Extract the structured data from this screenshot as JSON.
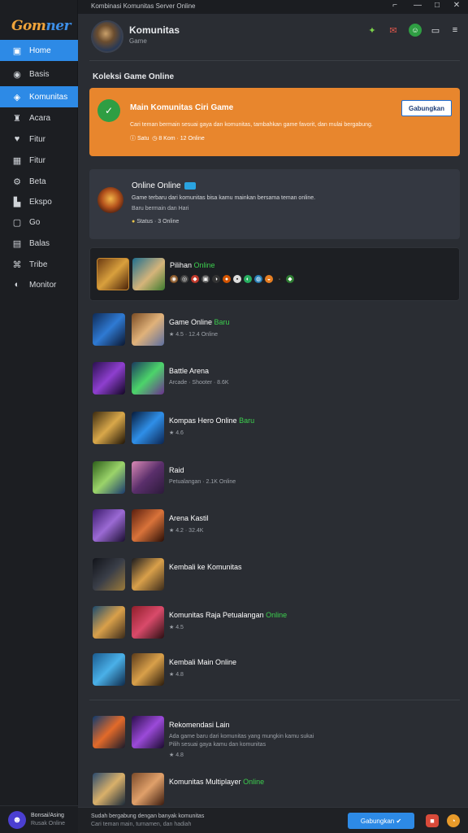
{
  "titlebar": {
    "text": "Kombinasi Komunitas Server Online",
    "pin": "⌐",
    "minimize": "—",
    "maximize": "□",
    "close": "✕"
  },
  "sidebar": {
    "logo_a": "Gom",
    "logo_b": "ner",
    "items": [
      {
        "label": "Home",
        "icon": "home-icon",
        "glyph": "▣"
      },
      {
        "label": "Basis",
        "icon": "compass-icon",
        "glyph": "◉"
      },
      {
        "label": "Komunitas",
        "icon": "community-icon",
        "glyph": "◈"
      },
      {
        "label": "Acara",
        "icon": "crown-icon",
        "glyph": "♜"
      },
      {
        "label": "Fitur",
        "icon": "heart-icon",
        "glyph": "♥"
      },
      {
        "label": "Fitur",
        "icon": "store-icon",
        "glyph": "▦"
      },
      {
        "label": "Beta",
        "icon": "settings-icon",
        "glyph": "⚙"
      },
      {
        "label": "Ekspo",
        "icon": "chart-icon",
        "glyph": "▙"
      },
      {
        "label": "Go",
        "icon": "box-icon",
        "glyph": "▢"
      },
      {
        "label": "Balas",
        "icon": "grid-icon",
        "glyph": "▤"
      },
      {
        "label": "Tribe",
        "icon": "branch-icon",
        "glyph": "⌘"
      },
      {
        "label": "Monitor",
        "icon": "globe-icon",
        "glyph": "◐"
      }
    ],
    "user_name": "Bonsai/Asing",
    "user_status": "Rusak Online"
  },
  "header": {
    "title": "Komunitas",
    "subtitle": "Game"
  },
  "section_title": "Koleksi Game Online",
  "promo": {
    "title": "Main Komunitas Ciri Game",
    "desc": "Cari teman bermain sesuai gaya dan komunitas, tambahkan game favorit, dan mulai bergabung.",
    "meta_a": "Satu",
    "meta_b": "8 Kom · 12 Online",
    "button": "Gabungkan"
  },
  "online_card": {
    "title": "Online Online",
    "desc": "Game terbaru dari komunitas bisa kamu mainkan bersama teman online.",
    "desc2": "Baru bermain dan Hari",
    "meta": "Status · 3 Online"
  },
  "featured": {
    "title": "Pilihan",
    "title_tag": "Online"
  },
  "games": [
    {
      "title": "Game Online",
      "tag": "Baru",
      "meta": "★ 4.5 · 12.4 Online"
    },
    {
      "title": "Battle Arena",
      "tag": "",
      "meta": "Arcade · Shooter · 8.6K"
    },
    {
      "title": "Kompas Hero Online",
      "tag": "Baru",
      "meta": "★ 4.6"
    },
    {
      "title": "Raid",
      "tag": "",
      "meta": "Petualangan · 2.1K Online"
    },
    {
      "title": "Arena Kastil",
      "tag": "",
      "meta": "★ 4.2 · 32.4K"
    },
    {
      "title": "Kembali ke Komunitas",
      "tag": "",
      "meta": ""
    },
    {
      "title": "Komunitas Raja Petualangan",
      "tag": "Online",
      "meta": "★ 4.5"
    },
    {
      "title": "Kembali Main Online",
      "tag": "",
      "meta": "★ 4.8"
    },
    {
      "title": "Rekomendasi Lain",
      "tag": "",
      "meta": "Ada game baru dari komunitas yang mungkin kamu sukai"
    },
    {
      "title": "Komunitas Multiplayer",
      "tag": "Online",
      "meta": ""
    }
  ],
  "recommend_meta2": "Pilih sesuai gaya kamu dan komunitas",
  "recommend_score": "★ 4.8",
  "bottombar": {
    "line1": "Sudah bergabung dengan banyak komunitas",
    "line2": "Cari teman main, turnamen, dan hadiah",
    "button": "Gabungkan"
  }
}
